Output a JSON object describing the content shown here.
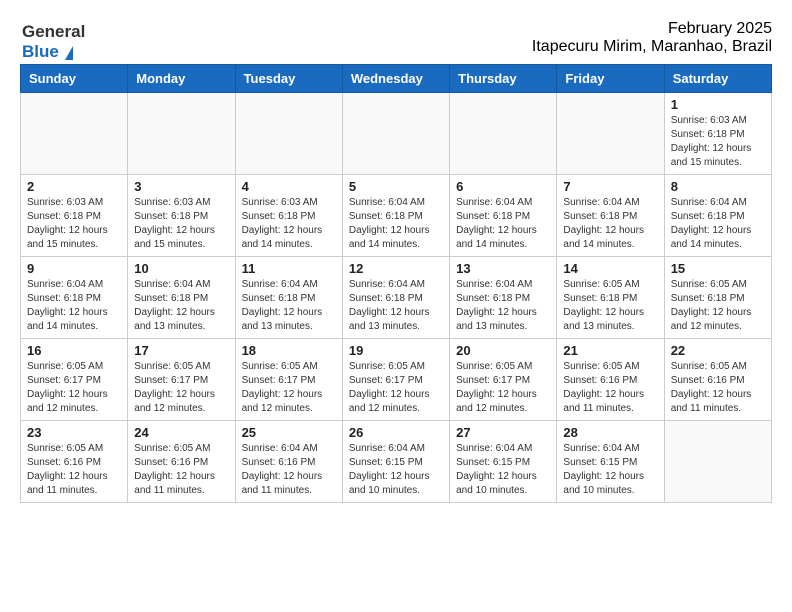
{
  "logo": {
    "general": "General",
    "blue": "Blue"
  },
  "header": {
    "title": "February 2025",
    "subtitle": "Itapecuru Mirim, Maranhao, Brazil"
  },
  "weekdays": [
    "Sunday",
    "Monday",
    "Tuesday",
    "Wednesday",
    "Thursday",
    "Friday",
    "Saturday"
  ],
  "weeks": [
    [
      {
        "day": "",
        "info": ""
      },
      {
        "day": "",
        "info": ""
      },
      {
        "day": "",
        "info": ""
      },
      {
        "day": "",
        "info": ""
      },
      {
        "day": "",
        "info": ""
      },
      {
        "day": "",
        "info": ""
      },
      {
        "day": "1",
        "info": "Sunrise: 6:03 AM\nSunset: 6:18 PM\nDaylight: 12 hours\nand 15 minutes."
      }
    ],
    [
      {
        "day": "2",
        "info": "Sunrise: 6:03 AM\nSunset: 6:18 PM\nDaylight: 12 hours\nand 15 minutes."
      },
      {
        "day": "3",
        "info": "Sunrise: 6:03 AM\nSunset: 6:18 PM\nDaylight: 12 hours\nand 15 minutes."
      },
      {
        "day": "4",
        "info": "Sunrise: 6:03 AM\nSunset: 6:18 PM\nDaylight: 12 hours\nand 14 minutes."
      },
      {
        "day": "5",
        "info": "Sunrise: 6:04 AM\nSunset: 6:18 PM\nDaylight: 12 hours\nand 14 minutes."
      },
      {
        "day": "6",
        "info": "Sunrise: 6:04 AM\nSunset: 6:18 PM\nDaylight: 12 hours\nand 14 minutes."
      },
      {
        "day": "7",
        "info": "Sunrise: 6:04 AM\nSunset: 6:18 PM\nDaylight: 12 hours\nand 14 minutes."
      },
      {
        "day": "8",
        "info": "Sunrise: 6:04 AM\nSunset: 6:18 PM\nDaylight: 12 hours\nand 14 minutes."
      }
    ],
    [
      {
        "day": "9",
        "info": "Sunrise: 6:04 AM\nSunset: 6:18 PM\nDaylight: 12 hours\nand 14 minutes."
      },
      {
        "day": "10",
        "info": "Sunrise: 6:04 AM\nSunset: 6:18 PM\nDaylight: 12 hours\nand 13 minutes."
      },
      {
        "day": "11",
        "info": "Sunrise: 6:04 AM\nSunset: 6:18 PM\nDaylight: 12 hours\nand 13 minutes."
      },
      {
        "day": "12",
        "info": "Sunrise: 6:04 AM\nSunset: 6:18 PM\nDaylight: 12 hours\nand 13 minutes."
      },
      {
        "day": "13",
        "info": "Sunrise: 6:04 AM\nSunset: 6:18 PM\nDaylight: 12 hours\nand 13 minutes."
      },
      {
        "day": "14",
        "info": "Sunrise: 6:05 AM\nSunset: 6:18 PM\nDaylight: 12 hours\nand 13 minutes."
      },
      {
        "day": "15",
        "info": "Sunrise: 6:05 AM\nSunset: 6:18 PM\nDaylight: 12 hours\nand 12 minutes."
      }
    ],
    [
      {
        "day": "16",
        "info": "Sunrise: 6:05 AM\nSunset: 6:17 PM\nDaylight: 12 hours\nand 12 minutes."
      },
      {
        "day": "17",
        "info": "Sunrise: 6:05 AM\nSunset: 6:17 PM\nDaylight: 12 hours\nand 12 minutes."
      },
      {
        "day": "18",
        "info": "Sunrise: 6:05 AM\nSunset: 6:17 PM\nDaylight: 12 hours\nand 12 minutes."
      },
      {
        "day": "19",
        "info": "Sunrise: 6:05 AM\nSunset: 6:17 PM\nDaylight: 12 hours\nand 12 minutes."
      },
      {
        "day": "20",
        "info": "Sunrise: 6:05 AM\nSunset: 6:17 PM\nDaylight: 12 hours\nand 12 minutes."
      },
      {
        "day": "21",
        "info": "Sunrise: 6:05 AM\nSunset: 6:16 PM\nDaylight: 12 hours\nand 11 minutes."
      },
      {
        "day": "22",
        "info": "Sunrise: 6:05 AM\nSunset: 6:16 PM\nDaylight: 12 hours\nand 11 minutes."
      }
    ],
    [
      {
        "day": "23",
        "info": "Sunrise: 6:05 AM\nSunset: 6:16 PM\nDaylight: 12 hours\nand 11 minutes."
      },
      {
        "day": "24",
        "info": "Sunrise: 6:05 AM\nSunset: 6:16 PM\nDaylight: 12 hours\nand 11 minutes."
      },
      {
        "day": "25",
        "info": "Sunrise: 6:04 AM\nSunset: 6:16 PM\nDaylight: 12 hours\nand 11 minutes."
      },
      {
        "day": "26",
        "info": "Sunrise: 6:04 AM\nSunset: 6:15 PM\nDaylight: 12 hours\nand 10 minutes."
      },
      {
        "day": "27",
        "info": "Sunrise: 6:04 AM\nSunset: 6:15 PM\nDaylight: 12 hours\nand 10 minutes."
      },
      {
        "day": "28",
        "info": "Sunrise: 6:04 AM\nSunset: 6:15 PM\nDaylight: 12 hours\nand 10 minutes."
      },
      {
        "day": "",
        "info": ""
      }
    ]
  ]
}
